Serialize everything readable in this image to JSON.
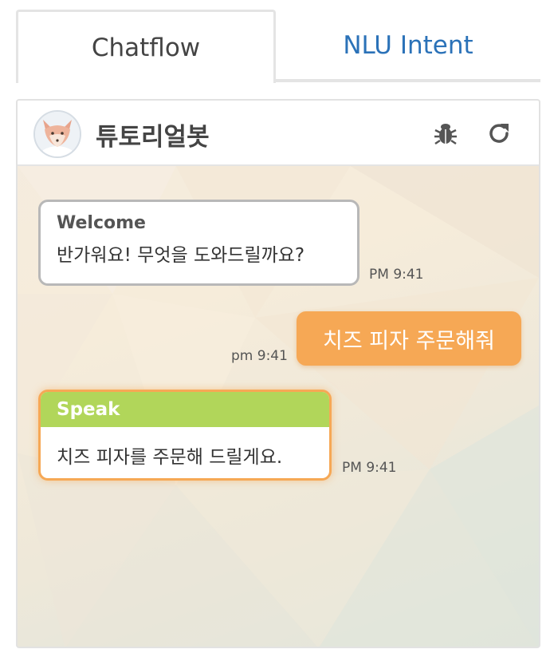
{
  "tabs": [
    {
      "label": "Chatflow",
      "active": true
    },
    {
      "label": "NLU Intent",
      "active": false
    }
  ],
  "header": {
    "bot_name": "튜토리얼봇",
    "avatar_icon": "fox-avatar-icon",
    "actions": [
      "bug-icon",
      "refresh-icon"
    ]
  },
  "messages": [
    {
      "sender": "bot",
      "type": "Welcome",
      "title": "Welcome",
      "text": "반가워요! 무엇을 도와드릴까요?",
      "time": "PM 9:41"
    },
    {
      "sender": "user",
      "text": "치즈 피자 주문해줘",
      "time": "pm 9:41"
    },
    {
      "sender": "bot",
      "type": "Speak",
      "title": "Speak",
      "text": "치즈 피자를 주문해 드릴게요.",
      "time": "PM 9:41"
    }
  ],
  "colors": {
    "tab_active_text": "#444444",
    "tab_inactive_text": "#2b72b8",
    "user_bubble": "#f6a855",
    "speak_header": "#b1d65a",
    "welcome_border": "#b8b8b8"
  }
}
